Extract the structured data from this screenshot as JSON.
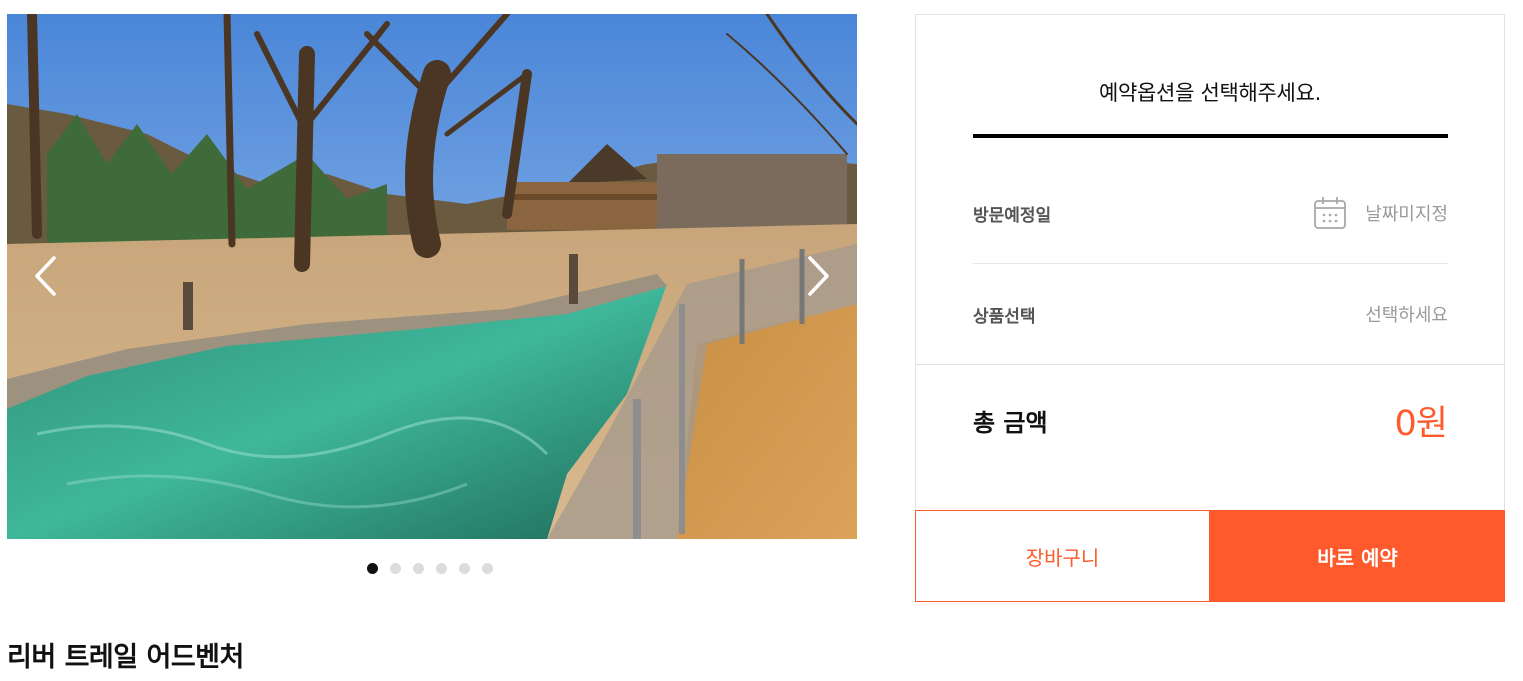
{
  "gallery": {
    "image_alt": "River trail pool with fence, trees and wooden lodge",
    "prev_icon": "chevron-left-icon",
    "next_icon": "chevron-right-icon",
    "slide_count": 6,
    "active_slide": 1
  },
  "product": {
    "title": "리버 트레일 어드벤처"
  },
  "booking": {
    "heading": "예약옵션을 선택해주세요.",
    "visit_date_label": "방문예정일",
    "visit_date_value": "날짜미지정",
    "visit_date_icon": "calendar-icon",
    "product_select_label": "상품선택",
    "product_select_value": "선택하세요",
    "total_label": "총 금액",
    "total_value": "0원"
  },
  "buttons": {
    "cart_label": "장바구니",
    "book_label": "바로 예약"
  },
  "colors": {
    "accent": "#ff5a2b",
    "dot_active": "#111111",
    "dot_inactive": "#dcdcdc"
  }
}
